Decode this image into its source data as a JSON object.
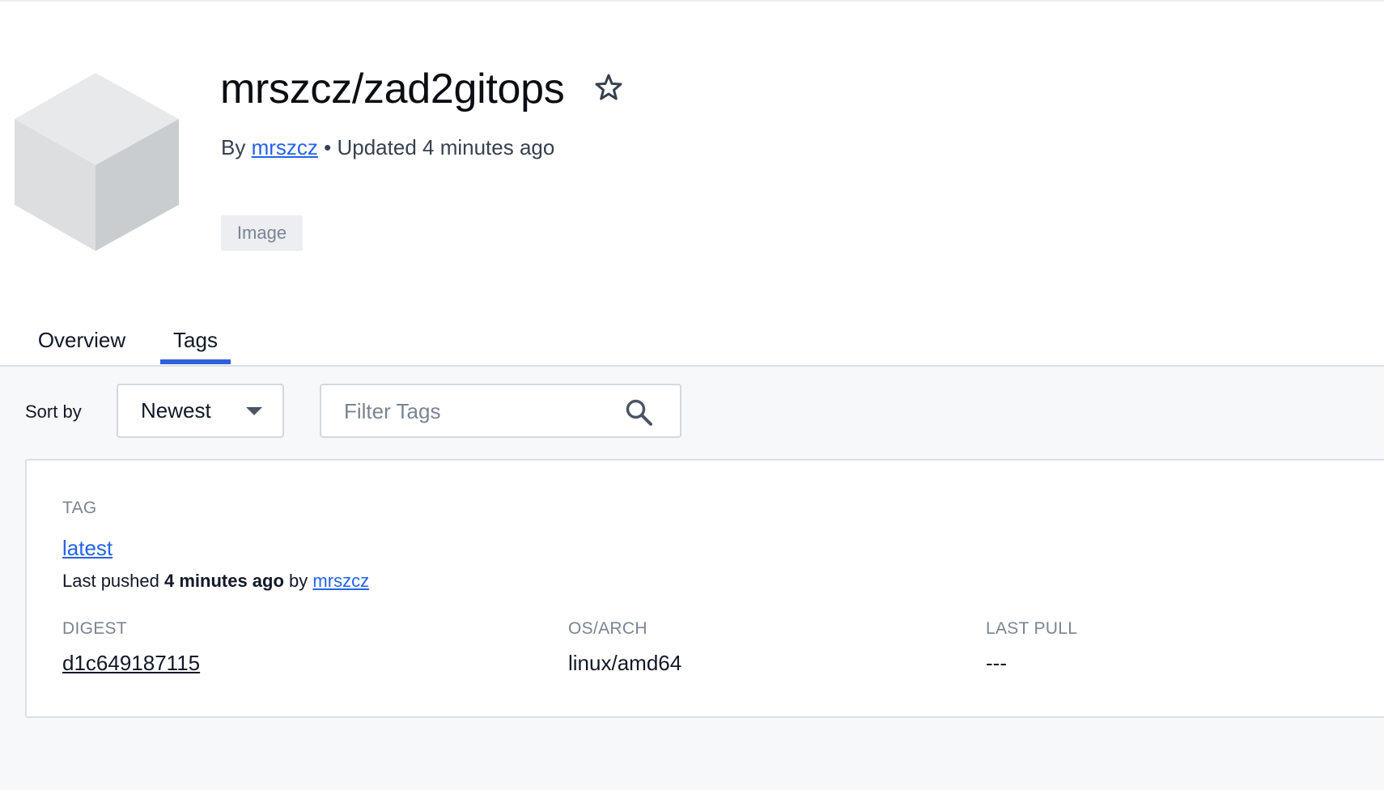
{
  "repo": {
    "title": "mrszcz/zad2gitops",
    "by_label": "By",
    "author": "mrszcz",
    "separator": "•",
    "updated": "Updated 4 minutes ago",
    "type_badge": "Image"
  },
  "tabs": [
    {
      "label": "Overview",
      "active": false
    },
    {
      "label": "Tags",
      "active": true
    }
  ],
  "toolbar": {
    "sort_label": "Sort by",
    "sort_value": "Newest",
    "filter_placeholder": "Filter Tags"
  },
  "tag_card": {
    "tag_header": "TAG",
    "tag_name": "latest",
    "pushed_prefix": "Last pushed",
    "pushed_time": "4 minutes ago",
    "pushed_by_label": "by",
    "pushed_by": "mrszcz",
    "columns": {
      "digest": "DIGEST",
      "os_arch": "OS/ARCH",
      "last_pull": "LAST PULL"
    },
    "row": {
      "digest": "d1c649187115",
      "os_arch": "linux/amd64",
      "last_pull": "---"
    }
  },
  "icons": {
    "logo": "cube-icon",
    "star": "star-icon",
    "search": "search-icon",
    "sort_caret": "caret-down-icon"
  },
  "colors": {
    "link": "#2463eb",
    "active_tab_underline": "#2f5fdb",
    "badge_bg": "#eceef1",
    "content_bg": "#f7f8f9"
  }
}
